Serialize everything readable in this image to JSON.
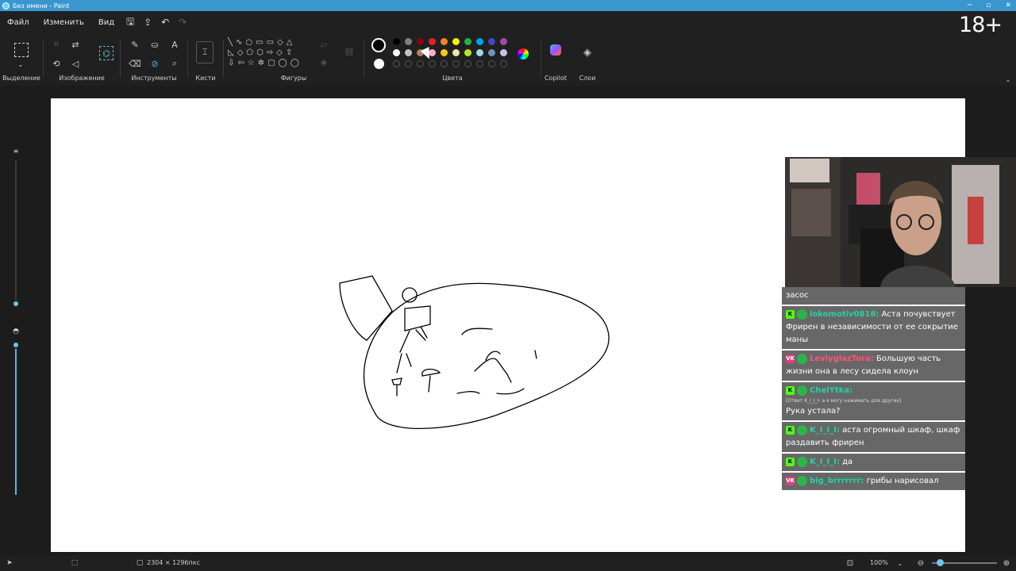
{
  "window": {
    "title": "Без имени - Paint"
  },
  "menu": {
    "file": "Файл",
    "edit": "Изменить",
    "view": "Вид"
  },
  "age_badge": "18+",
  "ribbon": {
    "selection": "Выделение",
    "image": "Изображение",
    "tools": "Инструменты",
    "brushes": "Кисти",
    "shapes": "Фигуры",
    "colors": "Цвета",
    "copilot": "Copilot",
    "layers": "Слои"
  },
  "palette": {
    "row1": [
      "#000000",
      "#7f7f7f",
      "#880015",
      "#ed1c24",
      "#ff7f27",
      "#fff200",
      "#22b14c",
      "#00a2e8",
      "#3f48cc",
      "#a349a4"
    ],
    "row2": [
      "#ffffff",
      "#c3c3c3",
      "#b97a57",
      "#ffaec9",
      "#ffc90e",
      "#efe4b0",
      "#b5e61d",
      "#99d9ea",
      "#7092be",
      "#c8bfe7"
    ]
  },
  "status": {
    "dimensions": "2304 × 1296пкс",
    "zoom": "100%"
  },
  "chat": [
    {
      "badge": "",
      "name": "",
      "text": "засос",
      "name_color": "#4ad0ff"
    },
    {
      "badge": "K",
      "name": "lokomotiv0816:",
      "text": "Аста почувствует Фрирен в независимости от ее сокрытие маны",
      "name_color": "#22d3a6"
    },
    {
      "badge": "VK",
      "name": "LevlyglazTora:",
      "text": "Большую часть жизни она в лесу сидела клоун",
      "name_color": "#ff5577"
    },
    {
      "badge": "K",
      "name": "ChelYtka:",
      "small": "[Ответ K_I_I_I: а я могу нажимать для других]",
      "text": "Рука устала?",
      "name_color": "#22d3a6"
    },
    {
      "badge": "K",
      "name": "K_I_I_I:",
      "text": "аста огромный шкаф, шкаф раздавить фрирен",
      "name_color": "#22d3a6"
    },
    {
      "badge": "K",
      "name": "K_I_I_I:",
      "text": "да",
      "name_color": "#22d3a6"
    },
    {
      "badge": "VK",
      "name": "big_brrrrrrr:",
      "text": "грибы нарисовал",
      "name_color": "#22d3a6"
    }
  ]
}
